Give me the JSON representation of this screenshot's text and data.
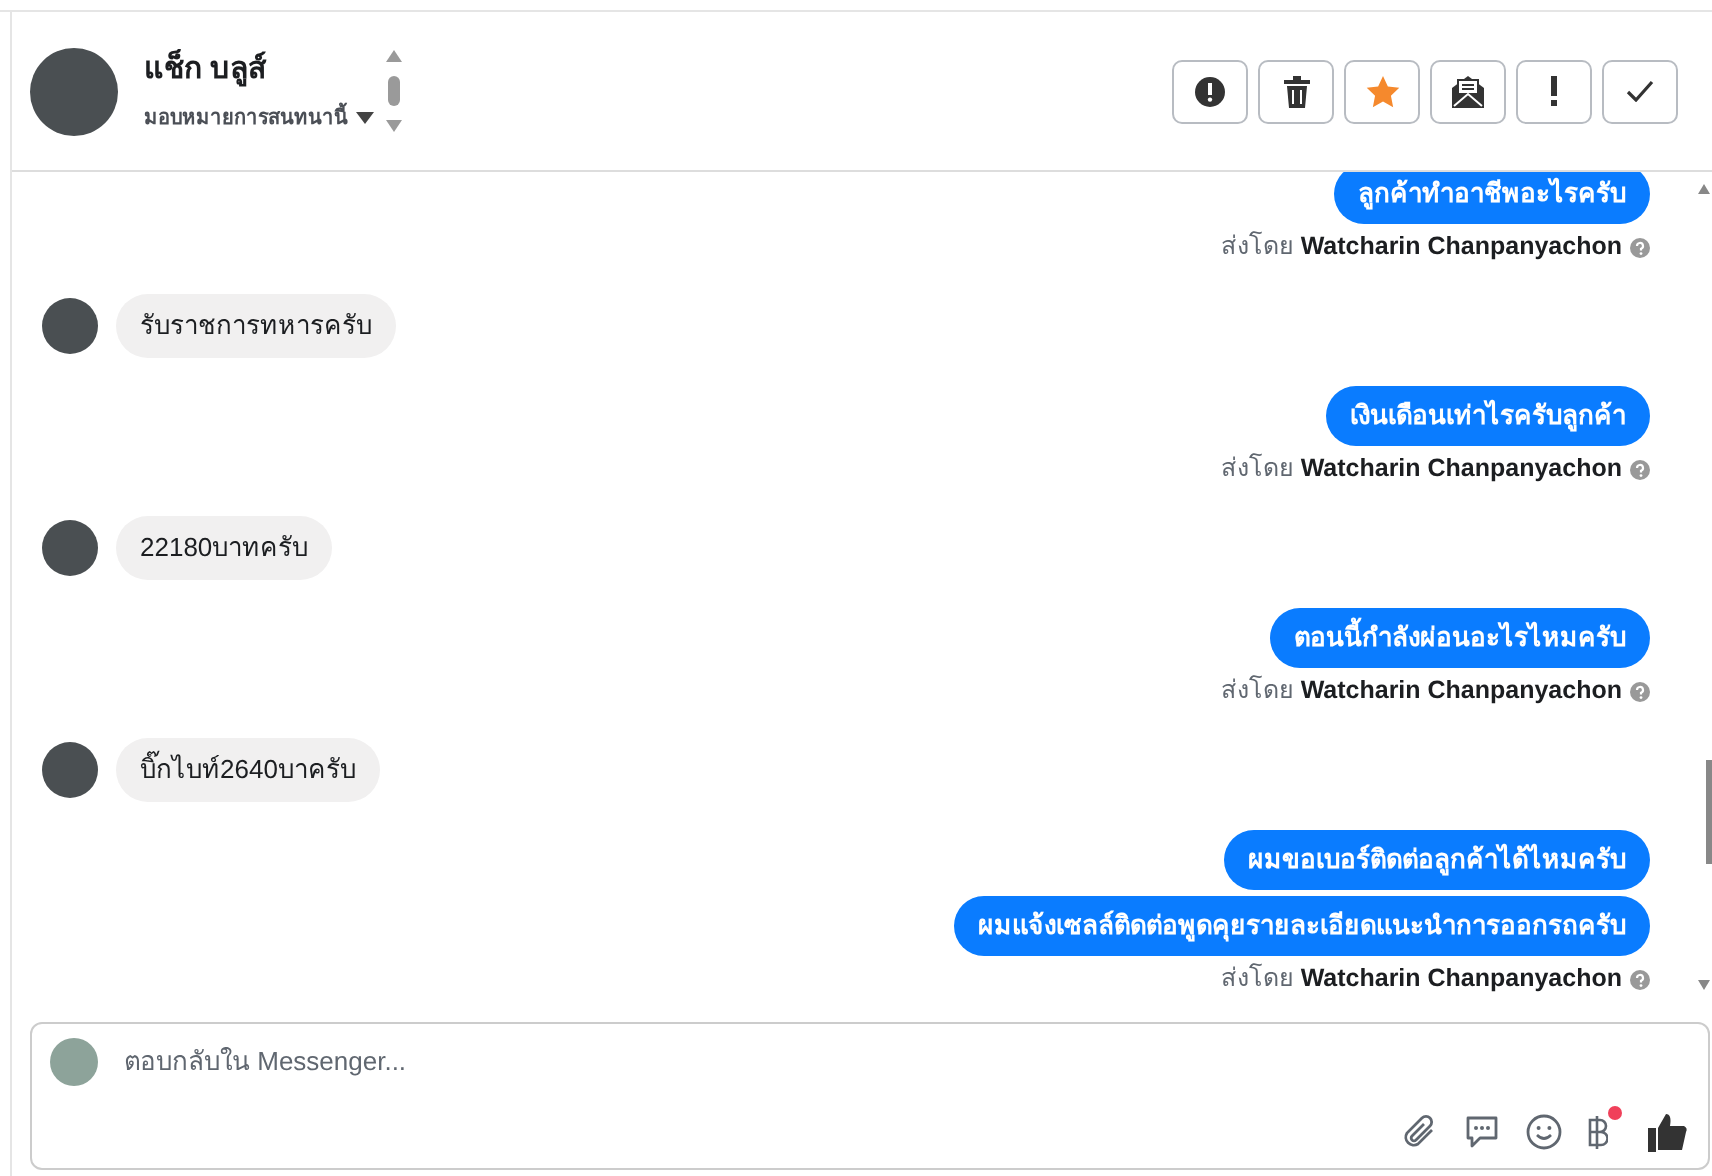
{
  "header": {
    "contact_name": "แช็ก บลูส์",
    "assign_label": "มอบหมายการสนทนานี้",
    "actions": [
      {
        "kind": "alert"
      },
      {
        "kind": "trash"
      },
      {
        "kind": "star"
      },
      {
        "kind": "mail"
      },
      {
        "kind": "important"
      },
      {
        "kind": "done"
      }
    ]
  },
  "messages": [
    {
      "kind": "out",
      "text": "ลูกค้าทำอาชีพอะไรครับ"
    },
    {
      "kind": "sent_by",
      "prefix": "ส่งโดย",
      "sender": "Watcharin Chanpanyachon"
    },
    {
      "kind": "in",
      "text": "รับราชการทหารครับ"
    },
    {
      "kind": "out",
      "text": "เงินเดือนเท่าไรครับลูกค้า"
    },
    {
      "kind": "sent_by",
      "prefix": "ส่งโดย",
      "sender": "Watcharin Chanpanyachon"
    },
    {
      "kind": "in",
      "text": "22180บาทครับ"
    },
    {
      "kind": "out",
      "text": "ตอนนี้กำลังผ่อนอะไรไหมครับ"
    },
    {
      "kind": "sent_by",
      "prefix": "ส่งโดย",
      "sender": "Watcharin Chanpanyachon"
    },
    {
      "kind": "in",
      "text": "บิ๊กไบท์2640บาครับ"
    },
    {
      "kind": "out",
      "text": "ผมขอเบอร์ติดต่อลูกค้าได้ไหมครับ"
    },
    {
      "kind": "out",
      "text": "ผมแจ้งเซลล์ติดต่อพูดคุยรายละเอียดแนะนำการออกรถครับ"
    },
    {
      "kind": "sent_by",
      "prefix": "ส่งโดย",
      "sender": "Watcharin Chanpanyachon"
    }
  ],
  "composer": {
    "placeholder": "ตอบกลับใน Messenger...",
    "tools": [
      {
        "kind": "attach"
      },
      {
        "kind": "saved_reply"
      },
      {
        "kind": "emoji"
      },
      {
        "kind": "payment",
        "badge": true
      },
      {
        "kind": "like"
      }
    ]
  }
}
